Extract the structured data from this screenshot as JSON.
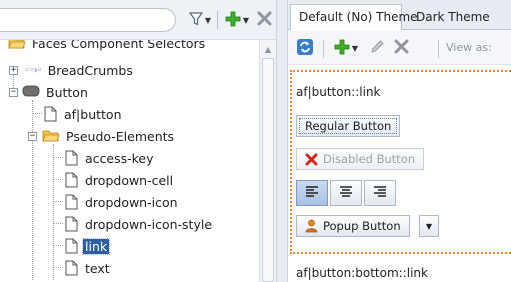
{
  "left_pane": {
    "toolbar": {
      "search_value": "",
      "filter_icon": "funnel-icon",
      "add_icon": "green-plus-icon",
      "remove_icon": "gray-x-icon"
    },
    "tree": {
      "items": [
        {
          "label": "Faces Component Selectors",
          "icon": "folder-open-icon"
        },
        {
          "label": "BreadCrumbs",
          "icon": "breadcrumbs-icon"
        },
        {
          "label": "Button",
          "icon": "button-icon"
        },
        {
          "label": "af|button",
          "icon": "file-icon"
        },
        {
          "label": "Pseudo-Elements",
          "icon": "folder-open-icon"
        },
        {
          "label": "access-key",
          "icon": "file-icon"
        },
        {
          "label": "dropdown-cell",
          "icon": "file-icon"
        },
        {
          "label": "dropdown-icon",
          "icon": "file-icon"
        },
        {
          "label": "dropdown-icon-style",
          "icon": "file-icon"
        },
        {
          "label": "link",
          "icon": "file-icon",
          "selected": true
        },
        {
          "label": "text",
          "icon": "file-icon"
        }
      ]
    }
  },
  "right_pane": {
    "tabs": [
      {
        "label": "Default (No) Theme",
        "active": true
      },
      {
        "label": "Dark Theme",
        "active": false
      }
    ],
    "toolbar": {
      "refresh_icon": "refresh-icon",
      "add_icon": "green-plus-icon",
      "edit_icon": "pencil-icon",
      "remove_icon": "gray-x-icon",
      "view_as_label": "View as:"
    },
    "preview": {
      "selector_1": "af|button::link",
      "regular_button": "Regular Button",
      "disabled_button": "Disabled Button",
      "align_buttons": [
        "align-left-icon",
        "align-center-icon",
        "align-right-icon"
      ],
      "popup_button": "Popup Button",
      "selector_2": "af|button:bottom::link"
    }
  },
  "colors": {
    "selection": "#2f5f9e",
    "preview_border": "#e2882f",
    "toolbar_bg": "#eef2f7"
  }
}
